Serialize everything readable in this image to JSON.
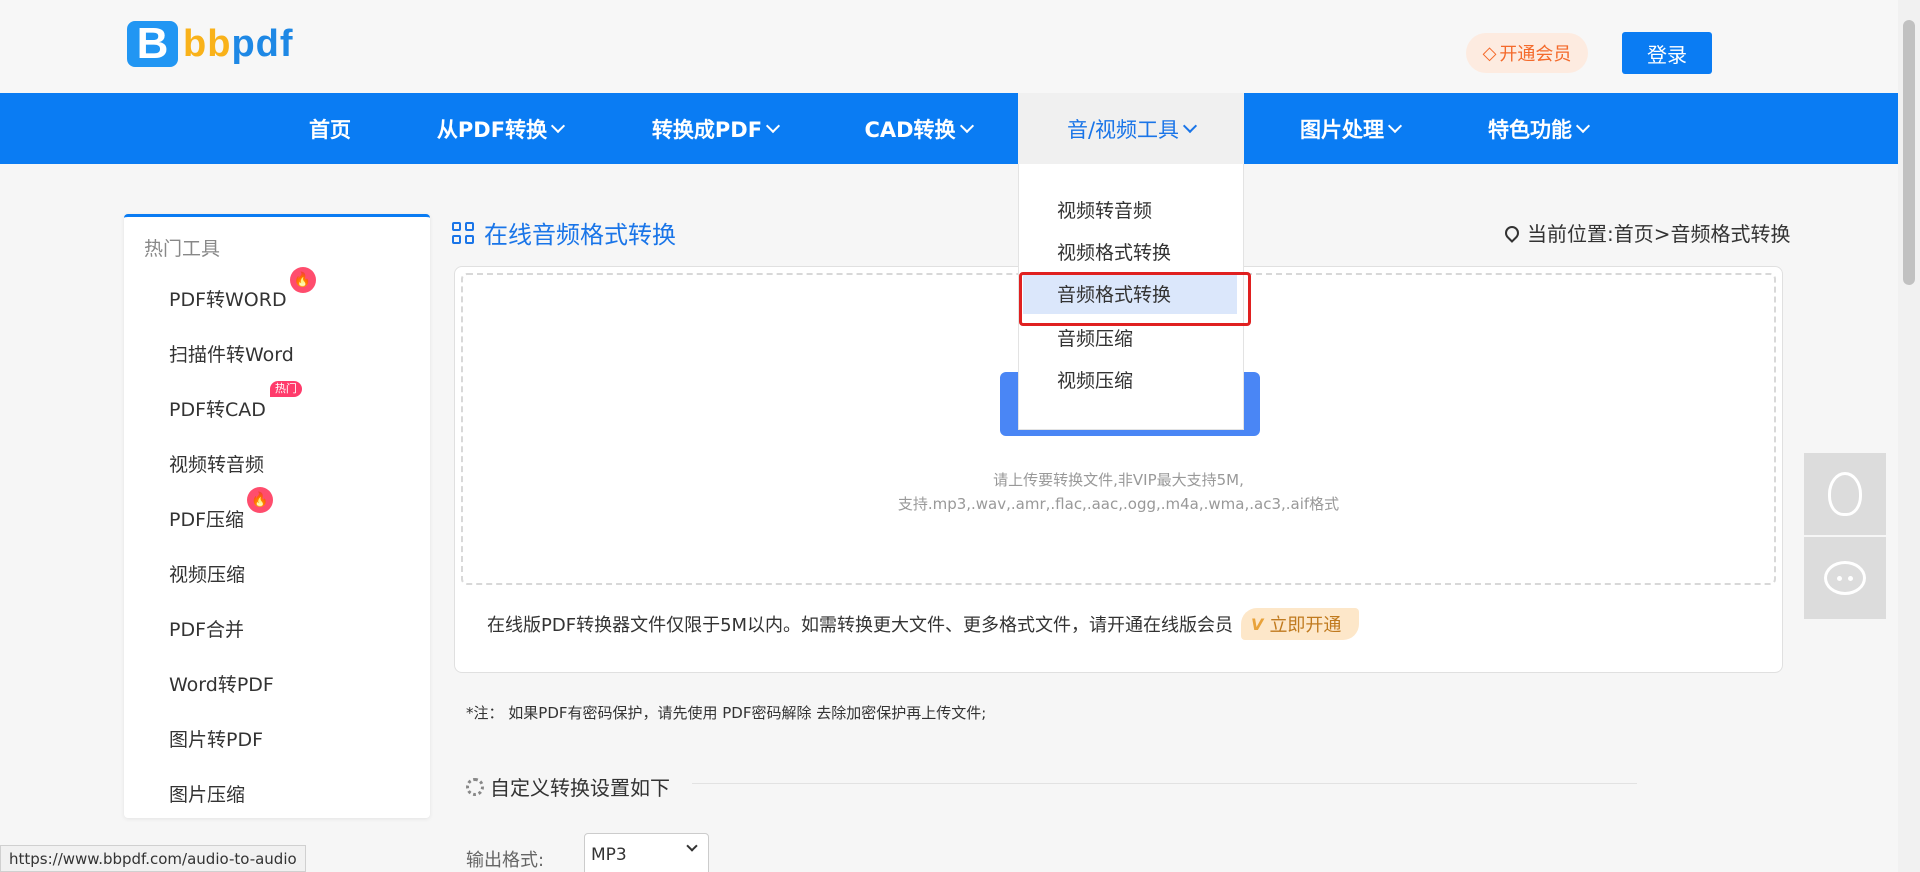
{
  "brand": {
    "logo_letter": "B",
    "name_part1": "bb",
    "name_part2": "pdf"
  },
  "header": {
    "vip_label": "开通会员",
    "login_label": "登录"
  },
  "nav": {
    "items": [
      {
        "label": "首页"
      },
      {
        "label": "从PDF转换"
      },
      {
        "label": "转换成PDF"
      },
      {
        "label": "CAD转换"
      },
      {
        "label": "音/视频工具"
      },
      {
        "label": "图片处理"
      },
      {
        "label": "特色功能"
      }
    ]
  },
  "dropdown": {
    "items": [
      "视频转音频",
      "视频格式转换",
      "音频格式转换",
      "音频压缩",
      "视频压缩"
    ],
    "selected": "音频格式转换"
  },
  "sidebar": {
    "title": "热门工具",
    "items": [
      {
        "label": "PDF转WORD",
        "badge": "fire"
      },
      {
        "label": "扫描件转Word"
      },
      {
        "label": "PDF转CAD",
        "badge_text": "热门"
      },
      {
        "label": "视频转音频"
      },
      {
        "label": "PDF压缩",
        "badge": "fire"
      },
      {
        "label": "视频压缩"
      },
      {
        "label": "PDF合并"
      },
      {
        "label": "Word转PDF"
      },
      {
        "label": "图片转PDF"
      },
      {
        "label": "图片压缩"
      }
    ]
  },
  "main": {
    "title": "在线音频格式转换",
    "breadcrumb": "当前位置:首页>音频格式转换",
    "upload_hint_1": "请上传要转换文件,非VIP最大支持5M,",
    "upload_hint_2": "支持.mp3,.wav,.amr,.flac,.aac,.ogg,.m4a,.wma,.ac3,.aif格式",
    "limit_note": "在线版PDF转换器文件仅限于5M以内。如需转换更大文件、更多格式文件，请开通在线版会员",
    "open_vip_label": "立即开通",
    "open_vip_mark": "V",
    "warn_note": "*注：  如果PDF有密码保护，请先使用 PDF密码解除 去除加密保护再上传文件;",
    "settings_title": "自定义转换设置如下",
    "output_label": "输出格式:",
    "output_value": "MP3"
  },
  "status_url": "https://www.bbpdf.com/audio-to-audio",
  "colors": {
    "primary": "#0a7cf3",
    "accent_orange": "#f46a2b",
    "highlight_red": "#e02020"
  }
}
